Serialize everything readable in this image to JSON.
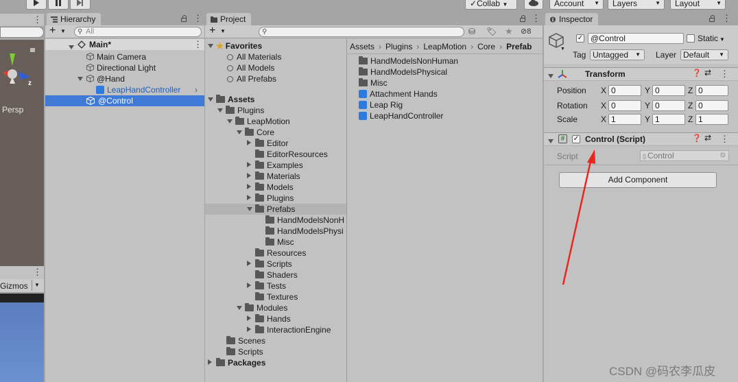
{
  "toolbar": {
    "collab_label": "Collab",
    "account_label": "Account",
    "layers_label": "Layers",
    "layout_label": "Layout"
  },
  "scene": {
    "persp_label": "Persp",
    "gizmos_label": "Gizmos",
    "axis_z": "z"
  },
  "hierarchy": {
    "tab_label": "Hierarchy",
    "search_placeholder": "All",
    "scene_name": "Main*",
    "items": [
      {
        "label": "Main Camera"
      },
      {
        "label": "Directional Light"
      },
      {
        "label": "@Hand"
      },
      {
        "label": "LeapHandController"
      },
      {
        "label": "@Control"
      }
    ]
  },
  "project": {
    "tab_label": "Project",
    "hidden_count": "8",
    "favorites": {
      "label": "Favorites",
      "items": [
        "All Materials",
        "All Models",
        "All Prefabs"
      ]
    },
    "tree": [
      "Assets",
      "Plugins",
      "LeapMotion",
      "Core",
      "Editor",
      "EditorResources",
      "Examples",
      "Materials",
      "Models",
      "Plugins",
      "Prefabs",
      "HandModelsNonH",
      "HandModelsPhysi",
      "Misc",
      "Resources",
      "Scripts",
      "Shaders",
      "Tests",
      "Textures",
      "Modules",
      "Hands",
      "InteractionEngine",
      "Scenes",
      "Scripts",
      "Packages"
    ],
    "breadcrumb": [
      "Assets",
      "Plugins",
      "LeapMotion",
      "Core",
      "Prefab"
    ],
    "contents": [
      {
        "label": "HandModelsNonHuman",
        "icon": "folder"
      },
      {
        "label": "HandModelsPhysical",
        "icon": "folder"
      },
      {
        "label": "Misc",
        "icon": "folder"
      },
      {
        "label": "Attachment Hands",
        "icon": "prefab"
      },
      {
        "label": "Leap Rig",
        "icon": "prefab"
      },
      {
        "label": "LeapHandController",
        "icon": "prefab"
      }
    ]
  },
  "inspector": {
    "tab_label": "Inspector",
    "object_name": "@Control",
    "static_label": "Static",
    "tag_label": "Tag",
    "tag_value": "Untagged",
    "layer_label": "Layer",
    "layer_value": "Default",
    "transform_label": "Transform",
    "position_label": "Position",
    "rotation_label": "Rotation",
    "scale_label": "Scale",
    "axis_x": "X",
    "axis_y": "Y",
    "axis_z": "Z",
    "position": [
      "0",
      "0",
      "0"
    ],
    "rotation": [
      "0",
      "0",
      "0"
    ],
    "scale": [
      "1",
      "1",
      "1"
    ],
    "script_component_label": "Control (Script)",
    "script_label": "Script",
    "script_value": "Control",
    "add_component_label": "Add Component"
  },
  "watermark": "CSDN @码农李瓜皮",
  "colors": {
    "selection": "#3e7ad6",
    "prefab_blue": "#2d7be0",
    "annotation_arrow": "#e8261e"
  }
}
